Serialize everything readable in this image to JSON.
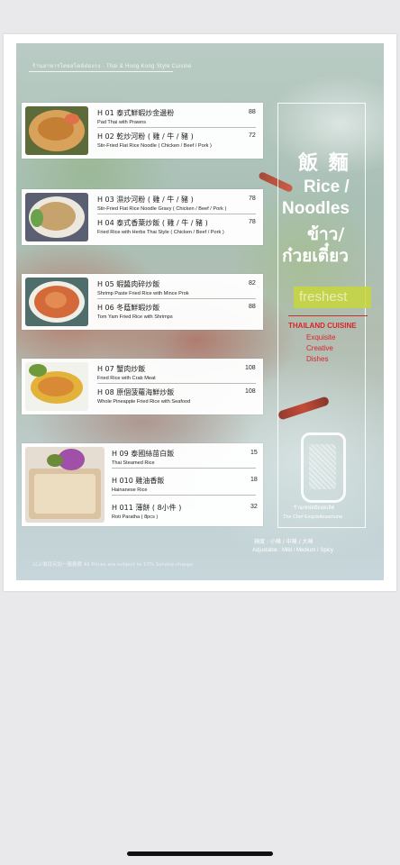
{
  "menu": {
    "top_caption": "ร้านอาหารไทยสไตล์ฮ่องกง · Thai & Hong Kong Style Cuisine",
    "category": {
      "cn": "飯 麵",
      "en_line1": "Rice /",
      "en_line2": "Noodles",
      "th_line1": "ข้าว/",
      "th_line2": "ก๋วยเตี๋ยว"
    },
    "freshest": "freshest",
    "thailand_cuisine": "THAILAND CUISINE",
    "exquisite": "Exquisite",
    "creative": "Creative",
    "dishes": "Dishes",
    "logo_th": "ร้านเชฟสมัยสุดเลิศ",
    "logo_en": "The Chef Exquisitesamurai",
    "spice_cn": "辣度 :  小辣 / 中辣 / 大辣",
    "spice_en": "Adjustable :   Mild / Medium / Spicy",
    "footer": "以上價目另加一服務費   All Prices are subject to 10% Service charge"
  },
  "items": [
    {
      "code_cn": "H 01  泰式鮮蝦炒金邊粉",
      "en": "Pad Thai with Prawns",
      "price": "88"
    },
    {
      "code_cn": "H 02  乾炒河粉 ( 雞 / 牛 / 豬 )",
      "en": "Stir-Fried Flat Rice Noodle ( Chicken / Beef / Pork )",
      "price": "72"
    },
    {
      "code_cn": "H 03  濕炒河粉 ( 雞 / 牛 / 豬 )",
      "en": "Stir-Fried Flat Rice Noodle Gravy ( Chicken / Beef / Pork )",
      "price": "78"
    },
    {
      "code_cn": "H 04  泰式香葉炒飯 ( 雞 / 牛 / 豬 )",
      "en": "Fried Rice with Herbs Thai Style ( Chicken / Beef / Pork )",
      "price": "78"
    },
    {
      "code_cn": "H 05  蝦醬肉碎炒飯",
      "en": "Shrimp Paste Fried Rice with Mince Prok",
      "price": "82"
    },
    {
      "code_cn": "H 06  冬蔭鮮蝦炒飯",
      "en": "Tom Yam  Fried Rice with Shrimps",
      "price": "88"
    },
    {
      "code_cn": "H 07  蟹肉炒飯",
      "en": "Fried Rice with Crab Meat",
      "price": "108"
    },
    {
      "code_cn": "H 08  原個菠蘿海鮮炒飯",
      "en": "Whole Pineapple Fried Rice with Seafood",
      "price": "108"
    },
    {
      "code_cn": "H 09  泰國絲苗白飯",
      "en": "Thai Steamed Rice",
      "price": "15"
    },
    {
      "code_cn": "H 010  雞油香飯",
      "en": "Hainanese Rice",
      "price": "18"
    },
    {
      "code_cn": "H 011  薄餅 ( 8小件 )",
      "en": "Roti Paratha ( 8pcs )",
      "price": "32"
    }
  ],
  "colors": {
    "accent_red": "#d8242b",
    "freshest_bg": "#c8d73c"
  }
}
